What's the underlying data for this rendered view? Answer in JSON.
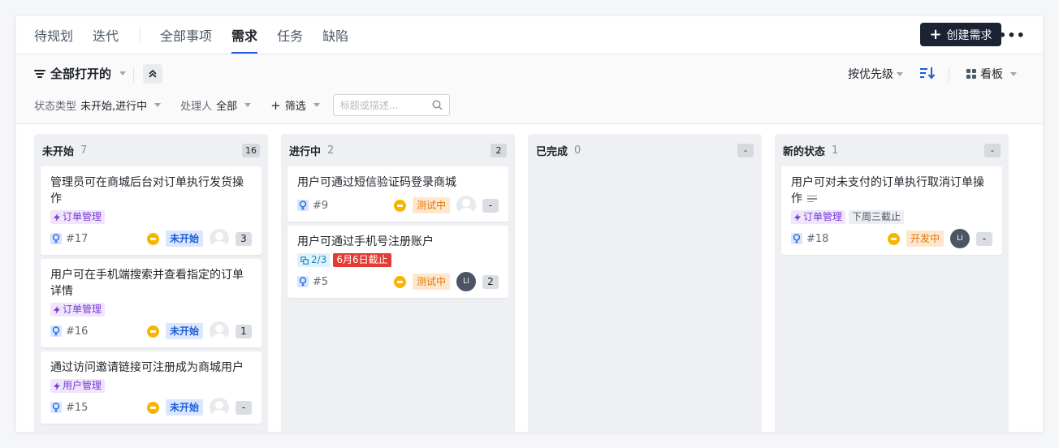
{
  "tabs": {
    "left": [
      "待规划",
      "迭代"
    ],
    "right": [
      "全部事项",
      "需求",
      "任务",
      "缺陷"
    ],
    "active": "需求"
  },
  "actions": {
    "create_label": "创建需求",
    "more": "•••"
  },
  "filters": {
    "view": "全部打开的",
    "sort": "按优先级",
    "display": "看板",
    "status_label": "状态类型",
    "status_value": "未开始,进行中",
    "assignee_label": "处理人",
    "assignee_value": "全部",
    "add_filter": "筛选",
    "search_placeholder": "标题或描述..."
  },
  "columns": [
    {
      "title": "未开始",
      "count": "7",
      "badge": "16",
      "cards": [
        {
          "title": "管理员可在商城后台对订单执行发货操作",
          "tags": [
            {
              "text": "订单管理",
              "style": "purple",
              "icon": "bolt"
            }
          ],
          "id": "#17",
          "status": "未开始",
          "status_style": "todo",
          "avatar": "empty",
          "badge": "3"
        },
        {
          "title": "用户可在手机端搜索并查看指定的订单详情",
          "tags": [
            {
              "text": "订单管理",
              "style": "purple",
              "icon": "bolt"
            }
          ],
          "id": "#16",
          "status": "未开始",
          "status_style": "todo",
          "avatar": "empty",
          "badge": "1"
        },
        {
          "title": "通过访问邀请链接可注册成为商城用户",
          "tags": [
            {
              "text": "用户管理",
              "style": "purple",
              "icon": "bolt"
            }
          ],
          "id": "#15",
          "status": "未开始",
          "status_style": "todo",
          "avatar": "empty",
          "badge": "-"
        }
      ]
    },
    {
      "title": "进行中",
      "count": "2",
      "badge": "2",
      "cards": [
        {
          "title": "用户可通过短信验证码登录商城",
          "tags": [],
          "id": "#9",
          "status": "测试中",
          "status_style": "testing",
          "avatar": "empty",
          "badge": "-"
        },
        {
          "title": "用户可通过手机号注册账户",
          "tags": [
            {
              "text": "2/3",
              "style": "blue-progress",
              "icon": "subtask"
            },
            {
              "text": "6月6日截止",
              "style": "red",
              "icon": ""
            }
          ],
          "id": "#5",
          "status": "测试中",
          "status_style": "testing",
          "avatar": "dark",
          "avatar_text": "LI",
          "badge": "2"
        }
      ]
    },
    {
      "title": "已完成",
      "count": "0",
      "badge": "-",
      "cards": []
    },
    {
      "title": "新的状态",
      "count": "1",
      "badge": "-",
      "cards": [
        {
          "title": "用户可对未支付的订单执行取消订单操作",
          "has_desc": true,
          "tags": [
            {
              "text": "订单管理",
              "style": "purple",
              "icon": "bolt"
            },
            {
              "text": "下周三截止",
              "style": "gray",
              "icon": ""
            }
          ],
          "id": "#18",
          "status": "开发中",
          "status_style": "dev",
          "avatar": "dark",
          "avatar_text": "LI",
          "badge": "-"
        }
      ]
    }
  ],
  "colors": {
    "accent": "#1e5bd9",
    "create_btn": "#1a2233",
    "priority": "#f7b500",
    "deadline_red": "#e23b33"
  }
}
